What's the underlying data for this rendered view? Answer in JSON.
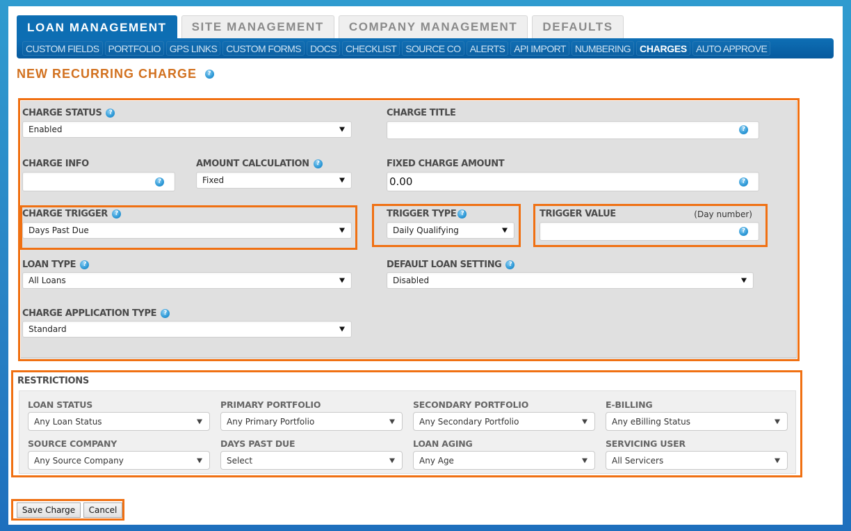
{
  "top_tabs": [
    {
      "label": "LOAN MANAGEMENT",
      "active": true
    },
    {
      "label": "SITE MANAGEMENT",
      "active": false
    },
    {
      "label": "COMPANY MANAGEMENT",
      "active": false
    },
    {
      "label": "DEFAULTS",
      "active": false
    }
  ],
  "sub_nav": [
    {
      "label": "CUSTOM FIELDS"
    },
    {
      "label": "PORTFOLIO"
    },
    {
      "label": "GPS LINKS"
    },
    {
      "label": "CUSTOM FORMS"
    },
    {
      "label": "DOCS"
    },
    {
      "label": "CHECKLIST"
    },
    {
      "label": "SOURCE CO"
    },
    {
      "label": "ALERTS"
    },
    {
      "label": "API IMPORT"
    },
    {
      "label": "NUMBERING"
    },
    {
      "label": "CHARGES",
      "active": true
    },
    {
      "label": "AUTO APPROVE"
    }
  ],
  "page_title": "NEW RECURRING CHARGE",
  "help_glyph": "?",
  "form": {
    "charge_status": {
      "label": "CHARGE STATUS",
      "value": "Enabled"
    },
    "charge_title": {
      "label": "CHARGE TITLE",
      "value": ""
    },
    "charge_info": {
      "label": "CHARGE INFO",
      "value": ""
    },
    "amount_calculation": {
      "label": "AMOUNT CALCULATION",
      "value": "Fixed"
    },
    "fixed_charge_amount": {
      "label": "FIXED CHARGE AMOUNT",
      "value": "0.00"
    },
    "charge_trigger": {
      "label": "CHARGE TRIGGER",
      "value": "Days Past Due"
    },
    "trigger_type": {
      "label": "TRIGGER TYPE",
      "value": "Daily Qualifying"
    },
    "trigger_value": {
      "label": "TRIGGER VALUE",
      "hint": "(Day number)",
      "value": ""
    },
    "loan_type": {
      "label": "LOAN TYPE",
      "value": "All Loans"
    },
    "default_loan_setting": {
      "label": "DEFAULT LOAN SETTING",
      "value": "Disabled"
    },
    "charge_application_type": {
      "label": "CHARGE APPLICATION TYPE",
      "value": "Standard"
    }
  },
  "restrictions": {
    "title": "RESTRICTIONS",
    "fields": [
      {
        "label": "LOAN STATUS",
        "value": "Any Loan Status"
      },
      {
        "label": "PRIMARY PORTFOLIO",
        "value": "Any Primary Portfolio"
      },
      {
        "label": "SECONDARY PORTFOLIO",
        "value": "Any Secondary Portfolio"
      },
      {
        "label": "E-BILLING",
        "value": "Any eBilling Status"
      },
      {
        "label": "SOURCE COMPANY",
        "value": "Any Source Company"
      },
      {
        "label": "DAYS PAST DUE",
        "value": "Select"
      },
      {
        "label": "LOAN AGING",
        "value": "Any Age"
      },
      {
        "label": "SERVICING USER",
        "value": "All Servicers"
      }
    ]
  },
  "buttons": {
    "save": "Save Charge",
    "cancel": "Cancel"
  },
  "colors": {
    "accent_orange": "#f07012",
    "title_orange": "#d2711f",
    "nav_blue": "#0d6eb3"
  }
}
